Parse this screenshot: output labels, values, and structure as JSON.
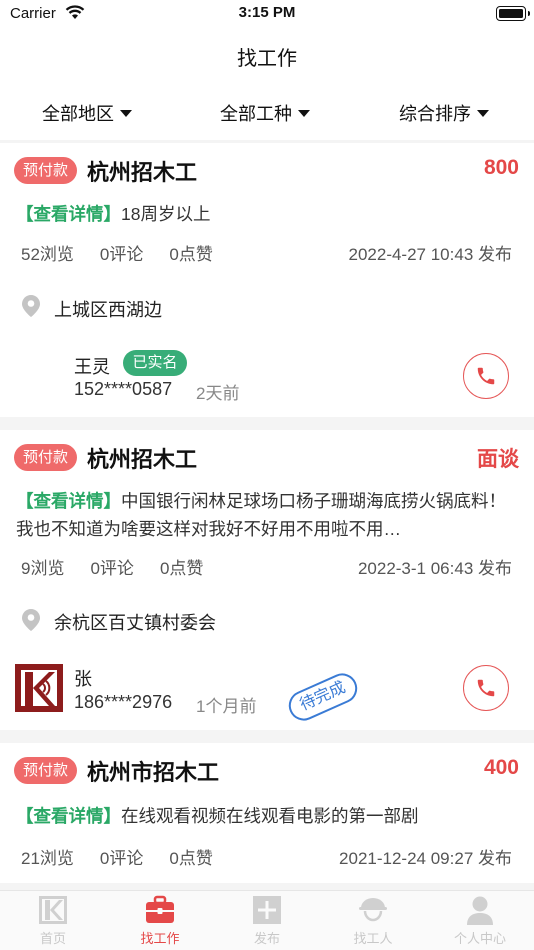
{
  "status_bar": {
    "carrier": "Carrier",
    "time": "3:15 PM"
  },
  "header": {
    "title": "找工作"
  },
  "filters": [
    {
      "label": "全部地区"
    },
    {
      "label": "全部工种"
    },
    {
      "label": "综合排序"
    }
  ],
  "jobs": [
    {
      "badge": "预付款",
      "title": "杭州招木工",
      "salary": "800",
      "detail_link": "【查看详情】",
      "description": "18周岁以上",
      "views": "52浏览",
      "comments": "0评论",
      "likes": "0点赞",
      "posted": "2022-4-27 10:43 发布",
      "location": "上城区西湖边",
      "poster_name": "王灵",
      "verified_label": "已实名",
      "phone": "152****0587",
      "time_ago": "2天前"
    },
    {
      "badge": "预付款",
      "title": "杭州招木工",
      "salary": "面谈",
      "detail_link": "【查看详情】",
      "description": "中国银行闲林足球场口杨子珊瑚海底捞火锅底料！我也不知道为啥要这样对我好不好用不用啦不用…",
      "views": "9浏览",
      "comments": "0评论",
      "likes": "0点赞",
      "posted": "2022-3-1 06:43 发布",
      "location": "余杭区百丈镇村委会",
      "poster_name": "张",
      "phone": "186****2976",
      "time_ago": "1个月前",
      "status_stamp": "待完成"
    },
    {
      "badge": "预付款",
      "title": "杭州市招木工",
      "salary": "400",
      "detail_link": "【查看详情】",
      "description": "在线观看视频在线观看电影的第一部剧",
      "views": "21浏览",
      "comments": "0评论",
      "likes": "0点赞",
      "posted": "2021-12-24 09:27 发布"
    }
  ],
  "tabbar": [
    {
      "label": "首页",
      "icon": "home-logo-icon"
    },
    {
      "label": "找工作",
      "icon": "briefcase-icon",
      "active": true
    },
    {
      "label": "发布",
      "icon": "plus-square-icon"
    },
    {
      "label": "找工人",
      "icon": "hardhat-worker-icon"
    },
    {
      "label": "个人中心",
      "icon": "person-icon"
    }
  ],
  "colors": {
    "accent_red": "#e44848",
    "badge_red": "#ef6a6a",
    "detail_green": "#2aa866",
    "verified_green": "#38ad78",
    "stamp_blue": "#3a7bd5"
  }
}
